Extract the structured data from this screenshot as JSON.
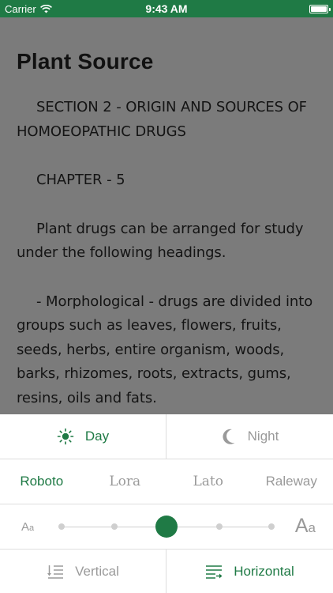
{
  "status": {
    "carrier": "Carrier",
    "time": "9:43 AM",
    "battery_level": 1.0
  },
  "article": {
    "title": "Plant Source",
    "paragraphs": [
      "SECTION 2 - ORIGIN AND SOURCES OF HOMOEOPATHIC DRUGS",
      "CHAPTER - 5",
      "Plant drugs can be arranged for study under the following headings.",
      "- Morphological - drugs are divided into groups such as leaves, flowers, fruits, seeds, herbs, entire organism, woods, barks, rhizomes, roots, extracts, gums, resins, oils and fats."
    ]
  },
  "settings": {
    "theme": {
      "day": "Day",
      "night": "Night",
      "selected": "Day"
    },
    "fonts": {
      "options": [
        "Roboto",
        "Lora",
        "Lato",
        "Raleway"
      ],
      "selected": "Roboto"
    },
    "size": {
      "small_label": {
        "big": "A",
        "small": "a"
      },
      "large_label": {
        "big": "A",
        "small": "a"
      },
      "steps": 5,
      "selected_step": 3
    },
    "layout": {
      "vertical": "Vertical",
      "horizontal": "Horizontal",
      "selected": "Horizontal"
    },
    "accent_color": "#1f7a45",
    "inactive_color": "#9a9a9a"
  },
  "icons": {
    "wifi": "wifi-icon",
    "battery": "battery-icon",
    "day": "sun-icon",
    "night": "moon-icon",
    "vertical": "vertical-scroll-icon",
    "horizontal": "horizontal-scroll-icon"
  }
}
